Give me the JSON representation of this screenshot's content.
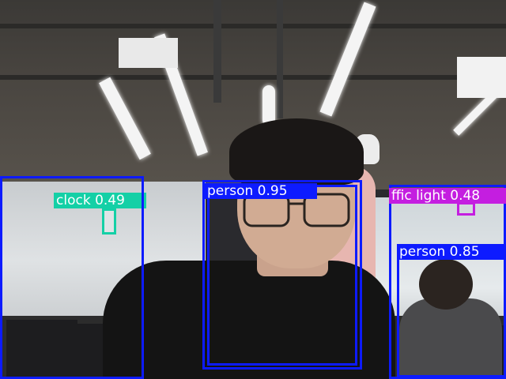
{
  "colors": {
    "person": "#0d1bff",
    "clock": "#14d0a6",
    "traffic_light": "#c41ee0"
  },
  "detections": [
    {
      "id": "clock",
      "label": "clock 0.49",
      "color_key": "clock"
    },
    {
      "id": "person_main",
      "label": "person 0.95",
      "color_key": "person"
    },
    {
      "id": "traffic_light",
      "label": "ffic light 0.48",
      "color_key": "traffic_light"
    },
    {
      "id": "person_right",
      "label": "person 0.85",
      "color_key": "person"
    },
    {
      "id": "person_left",
      "label": "",
      "color_key": "person"
    }
  ]
}
